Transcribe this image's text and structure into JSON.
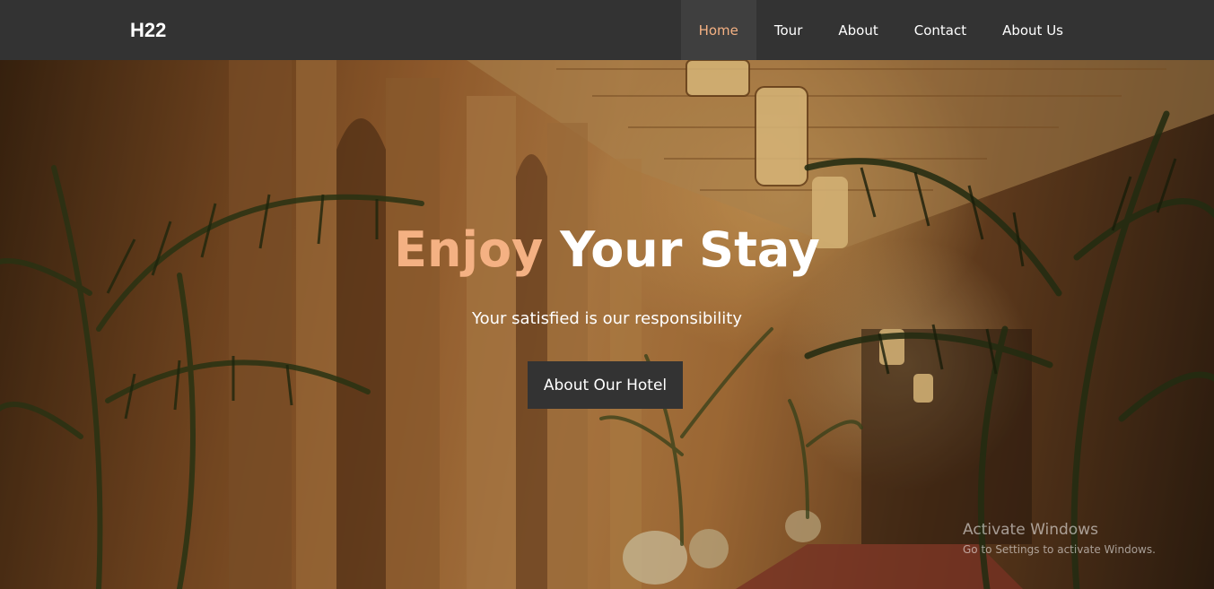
{
  "navbar": {
    "brand": "H22",
    "items": [
      {
        "label": "Home",
        "active": true
      },
      {
        "label": "Tour",
        "active": false
      },
      {
        "label": "About",
        "active": false
      },
      {
        "label": "Contact",
        "active": false
      },
      {
        "label": "About Us",
        "active": false
      }
    ]
  },
  "hero": {
    "title_accent": "Enjoy",
    "title_main": "Your Stay",
    "subtitle": "Your satisfied is our responsibility",
    "button_label": "About Our Hotel",
    "background": "hotel-lobby-photo"
  },
  "watermark": {
    "title": "Activate Windows",
    "subtitle": "Go to Settings to activate Windows."
  },
  "colors": {
    "nav_background": "#333333",
    "active_nav_background": "#3f3f3f",
    "accent": "#f4b183",
    "button_background": "#333333",
    "text": "#ffffff"
  }
}
